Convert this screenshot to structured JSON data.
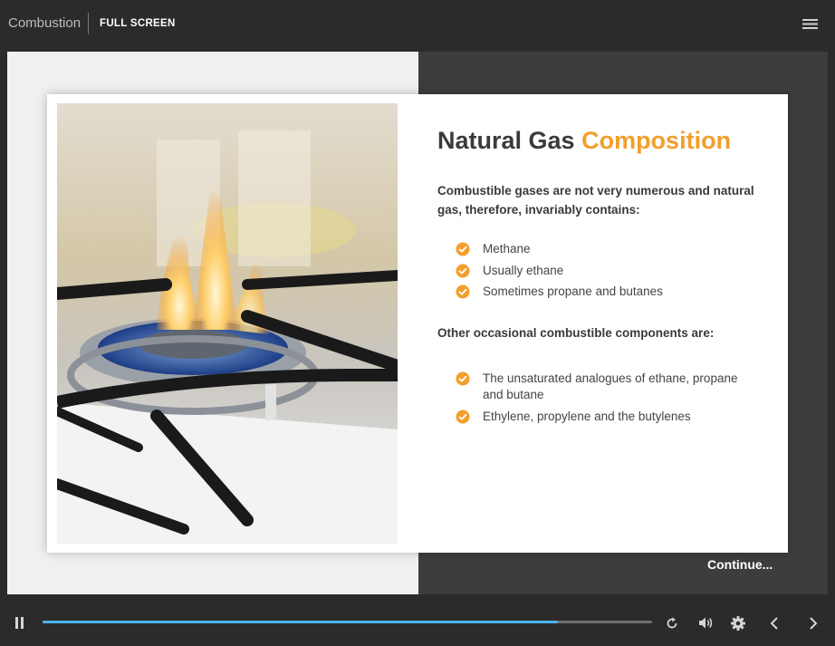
{
  "header": {
    "course_title": "Combustion",
    "fullscreen_label": "FULL SCREEN",
    "menu_icon": "hamburger-menu-icon"
  },
  "slide": {
    "title_main": "Natural Gas",
    "title_accent": "Composition",
    "intro": "Combustible gases are not very numerous and natural gas, therefore, invariably contains:",
    "list1": [
      "Methane",
      "Usually ethane",
      "Sometimes propane and butanes"
    ],
    "other_heading": "Other occasional combustible components are:",
    "list2": [
      "The unsaturated analogues of ethane, propane and butane",
      "Ethylene, propylene and the butylenes"
    ],
    "continue_label": "Continue...",
    "image": "gas-stove-burner-flame-photo"
  },
  "controls": {
    "progress_fraction": 0.845,
    "icons": [
      "pause-icon",
      "replay-icon",
      "volume-icon",
      "settings-gear-icon",
      "previous-arrow-icon",
      "next-arrow-icon"
    ]
  },
  "colors": {
    "accent": "#f29f2d",
    "progress": "#4cb1ee",
    "background": "#2b2b2b"
  }
}
